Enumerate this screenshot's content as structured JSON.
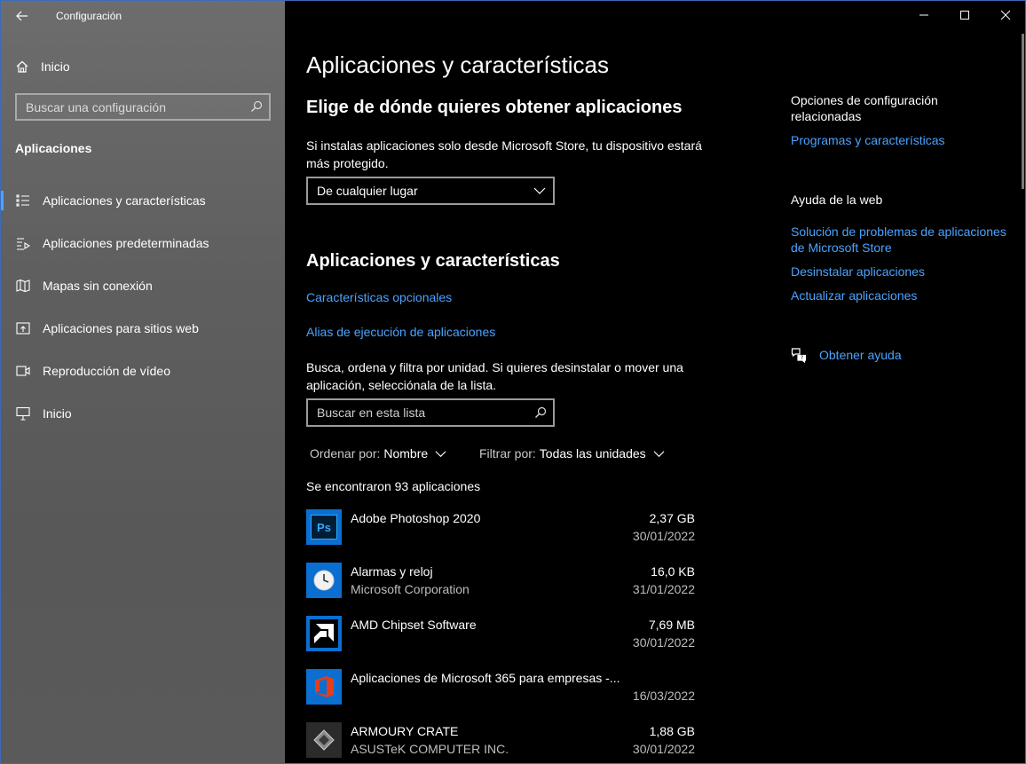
{
  "window": {
    "title": "Configuración"
  },
  "sidebar": {
    "home": "Inicio",
    "search_placeholder": "Buscar una configuración",
    "section": "Aplicaciones",
    "items": [
      {
        "label": "Aplicaciones y características",
        "icon": "list-icon",
        "active": true
      },
      {
        "label": "Aplicaciones predeterminadas",
        "icon": "default-apps-icon",
        "active": false
      },
      {
        "label": "Mapas sin conexión",
        "icon": "map-icon",
        "active": false
      },
      {
        "label": "Aplicaciones para sitios web",
        "icon": "web-app-icon",
        "active": false
      },
      {
        "label": "Reproducción de vídeo",
        "icon": "video-icon",
        "active": false
      },
      {
        "label": "Inicio",
        "icon": "startup-icon",
        "active": false
      }
    ]
  },
  "main": {
    "title": "Aplicaciones y características",
    "source": {
      "heading": "Elige de dónde quieres obtener aplicaciones",
      "description": "Si instalas aplicaciones solo desde Microsoft Store, tu dispositivo estará más protegido.",
      "dropdown_value": "De cualquier lugar"
    },
    "apps_section": {
      "heading": "Aplicaciones y características",
      "optional_link": "Características opcionales",
      "alias_link": "Alias de ejecución de aplicaciones",
      "description": "Busca, ordena y filtra por unidad. Si quieres desinstalar o mover una aplicación, selecciónala de la lista.",
      "search_placeholder": "Buscar en esta lista",
      "sort_label": "Ordenar por:",
      "sort_value": "Nombre",
      "filter_label": "Filtrar por:",
      "filter_value": "Todas las unidades",
      "count": "Se encontraron 93 aplicaciones"
    },
    "apps": [
      {
        "name": "Adobe Photoshop 2020",
        "publisher": "",
        "size": "2,37 GB",
        "date": "30/01/2022",
        "icon": "photoshop-icon",
        "icon_text": "Ps"
      },
      {
        "name": "Alarmas y reloj",
        "publisher": "Microsoft Corporation",
        "size": "16,0 KB",
        "date": "31/01/2022",
        "icon": "clock-icon",
        "icon_text": ""
      },
      {
        "name": "AMD Chipset Software",
        "publisher": "",
        "size": "7,69 MB",
        "date": "30/01/2022",
        "icon": "amd-icon",
        "icon_text": ""
      },
      {
        "name": "Aplicaciones de Microsoft 365 para empresas -...",
        "publisher": "",
        "size": "",
        "date": "16/03/2022",
        "icon": "office-icon",
        "icon_text": ""
      },
      {
        "name": "ARMOURY CRATE",
        "publisher": "ASUSTeK COMPUTER INC.",
        "size": "1,88 GB",
        "date": "30/01/2022",
        "icon": "armoury-crate-icon",
        "icon_text": ""
      }
    ]
  },
  "related": {
    "heading": "Opciones de configuración relacionadas",
    "programs_link": "Programas y características",
    "web_help_heading": "Ayuda de la web",
    "links": [
      "Solución de problemas de aplicaciones de Microsoft Store",
      "Desinstalar aplicaciones",
      "Actualizar aplicaciones"
    ],
    "get_help": "Obtener ayuda"
  },
  "colors": {
    "accent": "#4aa3ff",
    "sidebar": "#5f5f5f",
    "background": "#000000"
  }
}
